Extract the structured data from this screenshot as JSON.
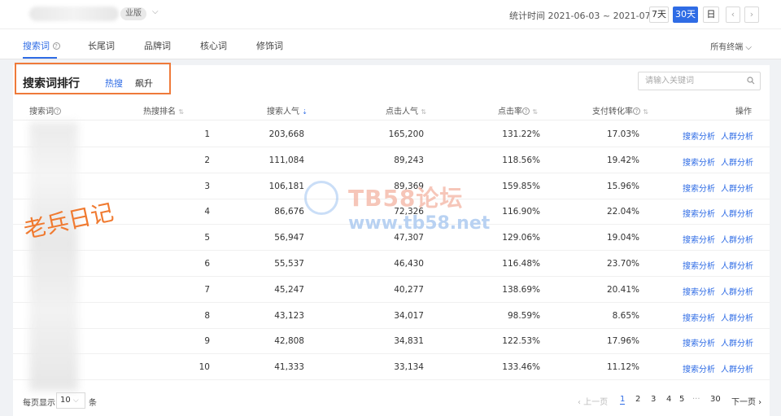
{
  "header": {
    "shop_suffix": "业版",
    "stat_time_label": "统计时间",
    "stat_time_value": "2021-06-03 ~ 2021-07-02",
    "ranges": [
      "7天",
      "30天",
      "日"
    ],
    "active_range": "30天",
    "prev_label": "‹",
    "next_label": "›"
  },
  "tabs": [
    "搜索词",
    "长尾词",
    "品牌词",
    "核心词",
    "修饰词"
  ],
  "terminal_label": "所有终端",
  "panel": {
    "title": "搜索词排行",
    "subtabs": [
      "热搜",
      "飙升"
    ],
    "search_placeholder": "请输入关键词"
  },
  "table": {
    "headers": [
      "搜索词",
      "热搜排名",
      "搜索人气",
      "点击人气",
      "点击率",
      "支付转化率",
      "操作"
    ],
    "rows": [
      {
        "rank": "1",
        "search": "203,668",
        "click": "165,200",
        "ctr": "131.22%",
        "cvr": "17.03%"
      },
      {
        "rank": "2",
        "search": "111,084",
        "click": "89,243",
        "ctr": "118.56%",
        "cvr": "19.42%"
      },
      {
        "rank": "3",
        "search": "106,181",
        "click": "89,369",
        "ctr": "159.85%",
        "cvr": "15.96%"
      },
      {
        "rank": "4",
        "search": "86,676",
        "click": "72,326",
        "ctr": "116.90%",
        "cvr": "22.04%"
      },
      {
        "rank": "5",
        "search": "56,947",
        "click": "47,307",
        "ctr": "129.06%",
        "cvr": "19.04%"
      },
      {
        "rank": "6",
        "search": "55,537",
        "click": "46,430",
        "ctr": "116.48%",
        "cvr": "23.70%"
      },
      {
        "rank": "7",
        "search": "45,247",
        "click": "40,277",
        "ctr": "138.69%",
        "cvr": "20.41%"
      },
      {
        "rank": "8",
        "search": "43,123",
        "click": "34,017",
        "ctr": "98.59%",
        "cvr": "8.65%"
      },
      {
        "rank": "9",
        "search": "42,808",
        "click": "34,831",
        "ctr": "122.53%",
        "cvr": "17.96%"
      },
      {
        "rank": "10",
        "search": "41,333",
        "click": "33,134",
        "ctr": "133.46%",
        "cvr": "11.12%"
      }
    ],
    "action_search": "搜索分析",
    "action_crowd": "人群分析"
  },
  "watermarks": {
    "brand": "TB58论坛",
    "url": "www.tb58.net",
    "handwriting": "老兵日记"
  },
  "footer": {
    "per_page_label": "每页显示",
    "per_page_value": "10",
    "per_page_unit": "条",
    "prev": "‹ 上一页",
    "pages": [
      "1",
      "2",
      "3",
      "4",
      "5",
      "···",
      "30"
    ],
    "next": "下一页 ›"
  },
  "colors": {
    "accent": "#2f6ce5",
    "highlight": "#ef7a3a"
  }
}
